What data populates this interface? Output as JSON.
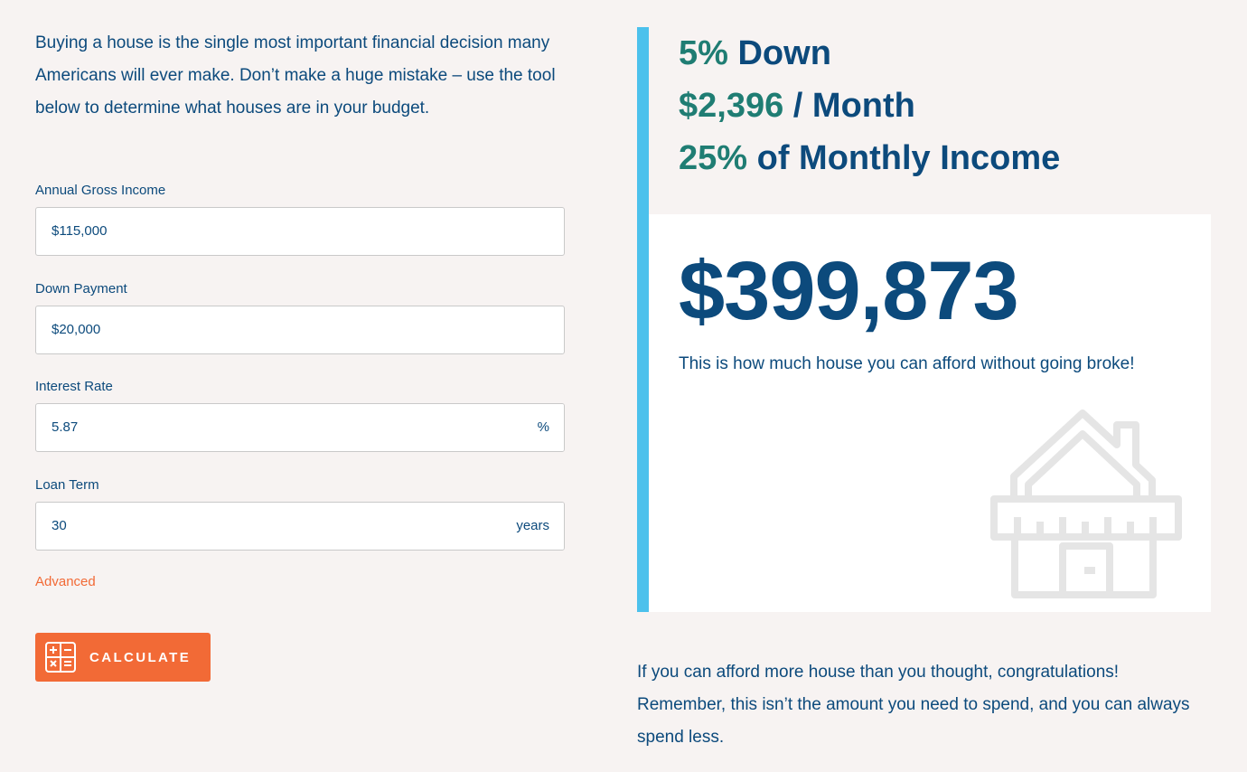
{
  "intro": "Buying a house is the single most important financial decision many Americans will ever make. Don’t make a huge mistake – use the tool below to determine what houses are in your budget.",
  "form": {
    "income": {
      "label": "Annual Gross Income",
      "value": "$115,000"
    },
    "down_payment": {
      "label": "Down Payment",
      "value": "$20,000"
    },
    "interest_rate": {
      "label": "Interest Rate",
      "value": "5.87",
      "suffix": "%"
    },
    "loan_term": {
      "label": "Loan Term",
      "value": "30",
      "suffix": "years"
    },
    "advanced_link": "Advanced",
    "calculate_label": "CALCULATE",
    "calculate_icon": "calculator-icon"
  },
  "summary": {
    "down_value": "5%",
    "down_text": "Down",
    "month_value": "$2,396",
    "month_text": "/ Month",
    "income_value": "25%",
    "income_text": "of Monthly Income"
  },
  "result": {
    "amount": "$399,873",
    "caption": "This is how much house you can afford without going broke!",
    "icon": "house-icon"
  },
  "footer": "If you can afford more house than you thought, congratulations! Remember, this isn’t the amount you need to spend, and you can always spend less.",
  "colors": {
    "primary": "#0c4a7c",
    "highlight": "#1f7d73",
    "accent_orange": "#f26a36",
    "accent_blue": "#4cc1ec",
    "background": "#f7f3f2"
  }
}
